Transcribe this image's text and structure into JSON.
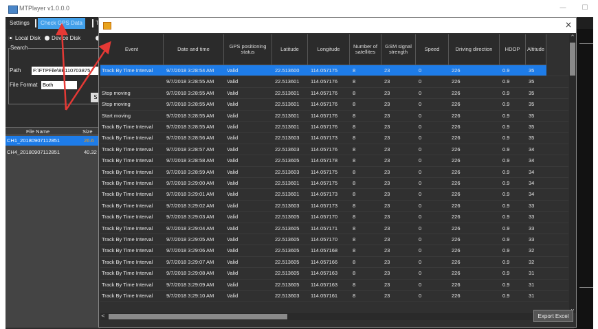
{
  "window": {
    "title": "MTPlayer v1.0.0.0",
    "minimize_glyph": "—",
    "maximize_glyph": "☐"
  },
  "tabs": [
    {
      "label": "Settings",
      "active": false
    },
    {
      "label": "Check GPS Data",
      "active": true
    },
    {
      "label": "T",
      "active": false
    }
  ],
  "left_panel": {
    "radio_local": "Local Disk",
    "radio_device": "Device Disk",
    "search_label": "Search",
    "path_label": "Path",
    "path_value": "F:\\FTPFile\\8E110703875",
    "file_format_label": "File Format",
    "file_format_value": "Both",
    "search_button": "S",
    "file_name_header": "File Name",
    "size_header": "Size",
    "files": [
      {
        "name": "CH1_20180907112851",
        "size": "26.6"
      },
      {
        "name": "CH4_20180907112851",
        "size": "40.32"
      }
    ]
  },
  "dialog": {
    "close_glyph": "×",
    "columns": [
      "Event",
      "Date and time",
      "GPS positioning status",
      "Latitude",
      "Longitude",
      "Number of satellites",
      "GSM signal strength",
      "Speed",
      "Driving direction",
      "HDOP",
      "Altitude"
    ],
    "rows": [
      [
        "Track By Time Interval",
        "9/7/2018 3:28:54 AM",
        "Valid",
        "22.513600",
        "114.057175",
        "8",
        "23",
        "0",
        "226",
        "0.9",
        "35"
      ],
      [
        "",
        "9/7/2018 3:28:55 AM",
        "Valid",
        "22.513601",
        "114.057176",
        "8",
        "23",
        "0",
        "226",
        "0.9",
        "35"
      ],
      [
        "Stop moving",
        "9/7/2018 3:28:55 AM",
        "Valid",
        "22.513601",
        "114.057176",
        "8",
        "23",
        "0",
        "226",
        "0.9",
        "35"
      ],
      [
        "Stop moving",
        "9/7/2018 3:28:55 AM",
        "Valid",
        "22.513601",
        "114.057176",
        "8",
        "23",
        "0",
        "226",
        "0.9",
        "35"
      ],
      [
        "Start moving",
        "9/7/2018 3:28:55 AM",
        "Valid",
        "22.513601",
        "114.057176",
        "8",
        "23",
        "0",
        "226",
        "0.9",
        "35"
      ],
      [
        "Track By Time Interval",
        "9/7/2018 3:28:55 AM",
        "Valid",
        "22.513601",
        "114.057176",
        "8",
        "23",
        "0",
        "226",
        "0.9",
        "35"
      ],
      [
        "Track By Time Interval",
        "9/7/2018 3:28:56 AM",
        "Valid",
        "22.513603",
        "114.057173",
        "8",
        "23",
        "0",
        "226",
        "0.9",
        "35"
      ],
      [
        "Track By Time Interval",
        "9/7/2018 3:28:57 AM",
        "Valid",
        "22.513603",
        "114.057176",
        "8",
        "23",
        "0",
        "226",
        "0.9",
        "34"
      ],
      [
        "Track By Time Interval",
        "9/7/2018 3:28:58 AM",
        "Valid",
        "22.513605",
        "114.057178",
        "8",
        "23",
        "0",
        "226",
        "0.9",
        "34"
      ],
      [
        "Track By Time Interval",
        "9/7/2018 3:28:59 AM",
        "Valid",
        "22.513603",
        "114.057175",
        "8",
        "23",
        "0",
        "226",
        "0.9",
        "34"
      ],
      [
        "Track By Time Interval",
        "9/7/2018 3:29:00 AM",
        "Valid",
        "22.513601",
        "114.057175",
        "8",
        "23",
        "0",
        "226",
        "0.9",
        "34"
      ],
      [
        "Track By Time Interval",
        "9/7/2018 3:29:01 AM",
        "Valid",
        "22.513601",
        "114.057173",
        "8",
        "23",
        "0",
        "226",
        "0.9",
        "34"
      ],
      [
        "Track By Time Interval",
        "9/7/2018 3:29:02 AM",
        "Valid",
        "22.513603",
        "114.057173",
        "8",
        "23",
        "0",
        "226",
        "0.9",
        "33"
      ],
      [
        "Track By Time Interval",
        "9/7/2018 3:29:03 AM",
        "Valid",
        "22.513605",
        "114.057170",
        "8",
        "23",
        "0",
        "226",
        "0.9",
        "33"
      ],
      [
        "Track By Time Interval",
        "9/7/2018 3:29:04 AM",
        "Valid",
        "22.513605",
        "114.057171",
        "8",
        "23",
        "0",
        "226",
        "0.9",
        "33"
      ],
      [
        "Track By Time Interval",
        "9/7/2018 3:29:05 AM",
        "Valid",
        "22.513605",
        "114.057170",
        "8",
        "23",
        "0",
        "226",
        "0.9",
        "33"
      ],
      [
        "Track By Time Interval",
        "9/7/2018 3:29:06 AM",
        "Valid",
        "22.513605",
        "114.057168",
        "8",
        "23",
        "0",
        "226",
        "0.9",
        "32"
      ],
      [
        "Track By Time Interval",
        "9/7/2018 3:29:07 AM",
        "Valid",
        "22.513605",
        "114.057166",
        "8",
        "23",
        "0",
        "226",
        "0.9",
        "32"
      ],
      [
        "Track By Time Interval",
        "9/7/2018 3:29:08 AM",
        "Valid",
        "22.513605",
        "114.057163",
        "8",
        "23",
        "0",
        "226",
        "0.9",
        "31"
      ],
      [
        "Track By Time Interval",
        "9/7/2018 3:29:09 AM",
        "Valid",
        "22.513605",
        "114.057163",
        "8",
        "23",
        "0",
        "226",
        "0.9",
        "31"
      ],
      [
        "Track By Time Interval",
        "9/7/2018 3:29:10 AM",
        "Valid",
        "22.513603",
        "114.057161",
        "8",
        "23",
        "0",
        "226",
        "0.9",
        "31"
      ]
    ],
    "selected_row": 0,
    "scroll_left_glyph": "<",
    "scroll_right_glyph": ">",
    "scroll_up_glyph": "^",
    "scroll_down_glyph": "v",
    "export_button": "Export Excel"
  },
  "colors": {
    "selection": "#1e7ce8",
    "annotation_arrow": "#e53935",
    "dialog_bg": "#303030",
    "panel_bg": "#2d2d2d"
  }
}
